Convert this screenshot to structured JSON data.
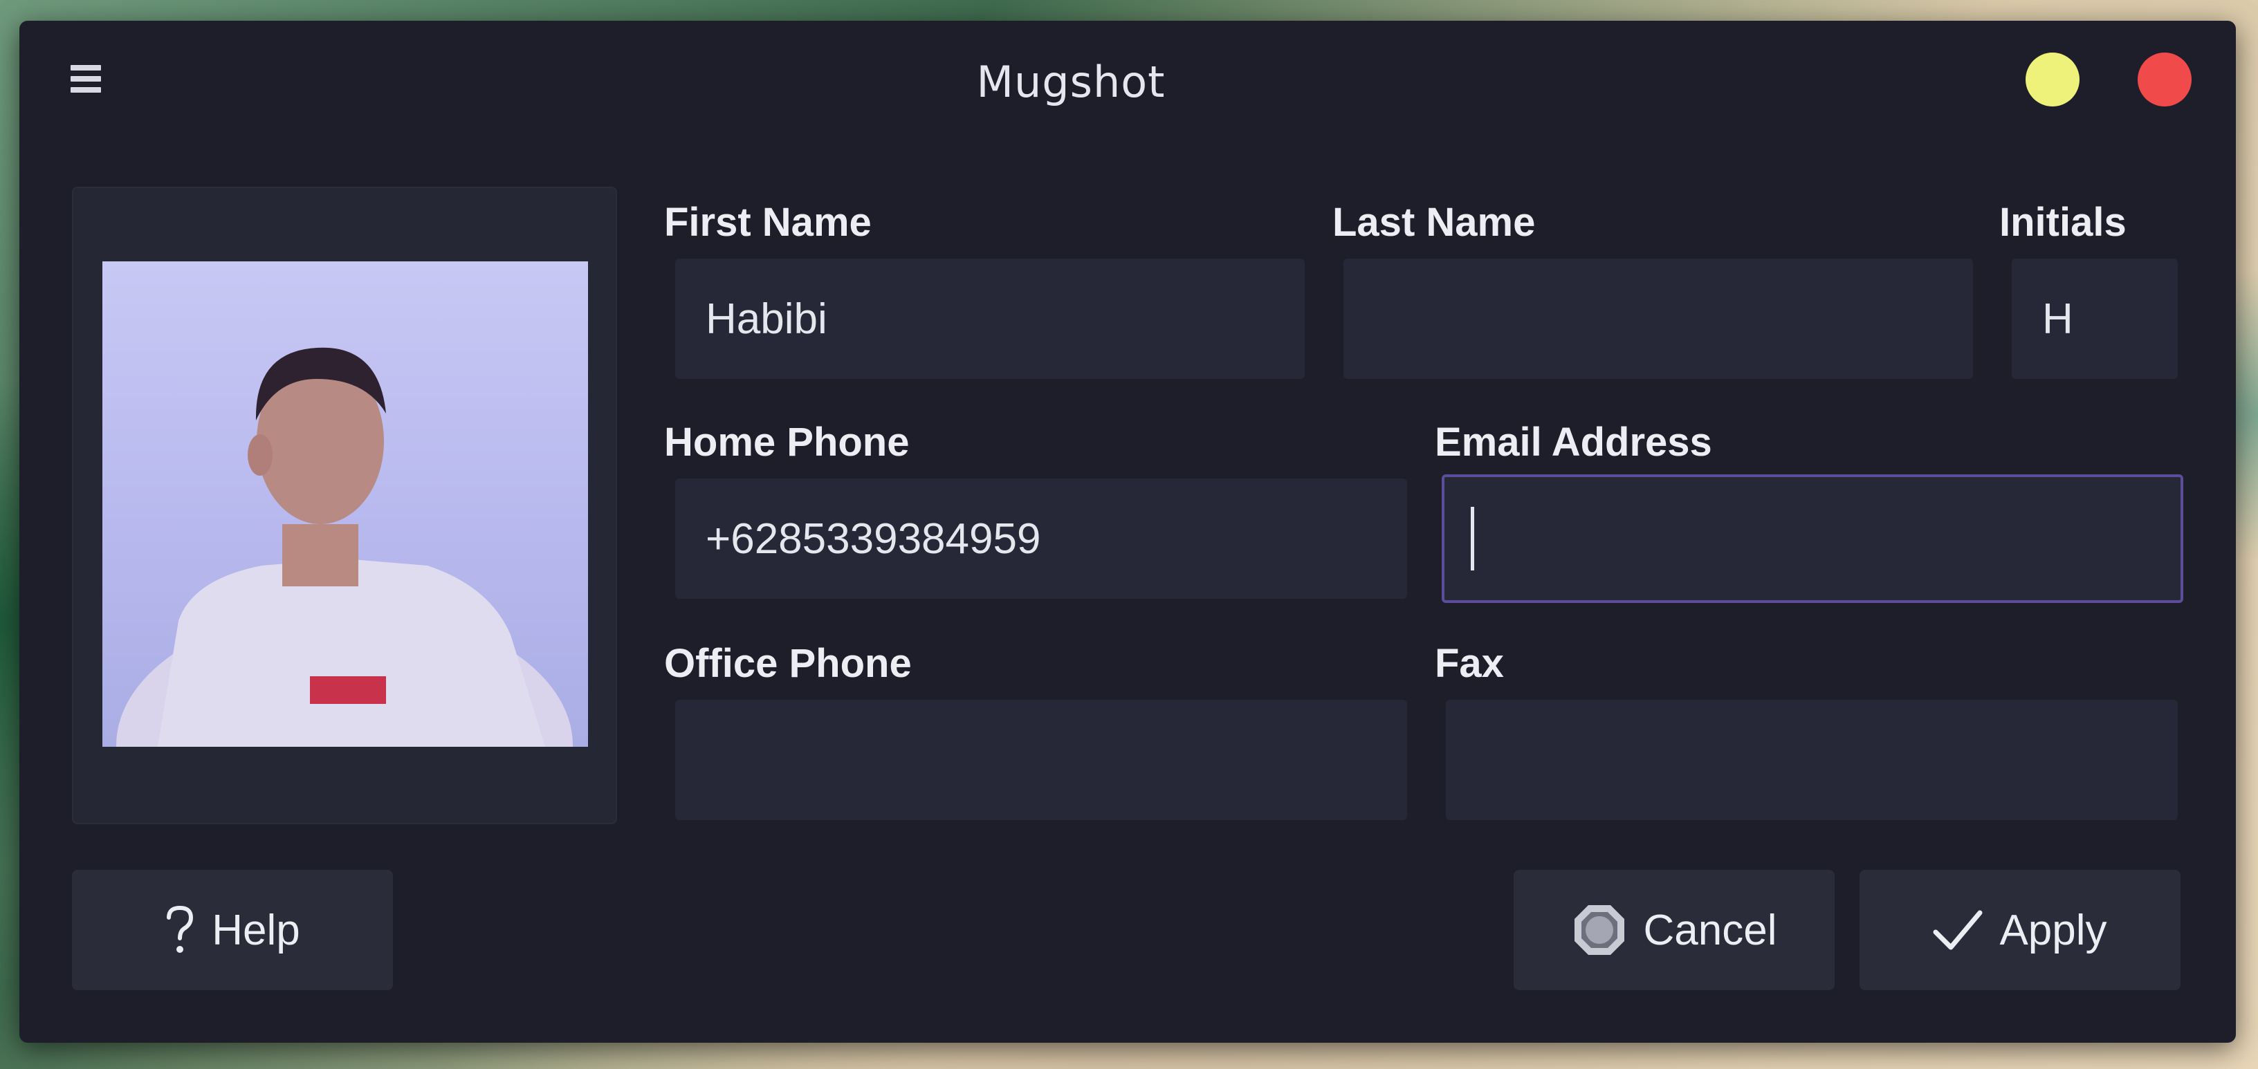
{
  "window": {
    "title": "Mugshot",
    "menu_icon": "hamburger-menu-icon",
    "minimize_icon": "yellow-circle-icon",
    "close_icon": "red-circle-icon"
  },
  "form": {
    "first_name": {
      "label": "First Name",
      "value": "Habibi"
    },
    "last_name": {
      "label": "Last Name",
      "value": ""
    },
    "initials": {
      "label": "Initials",
      "value": "H"
    },
    "home_phone": {
      "label": "Home Phone",
      "value": "+6285339384959"
    },
    "email": {
      "label": "Email Address",
      "value": ""
    },
    "office_phone": {
      "label": "Office Phone",
      "value": ""
    },
    "fax": {
      "label": "Fax",
      "value": ""
    }
  },
  "buttons": {
    "help": {
      "label": "Help",
      "icon": "question-mark-icon"
    },
    "cancel": {
      "label": "Cancel",
      "icon": "stop-octagon-icon"
    },
    "apply": {
      "label": "Apply",
      "icon": "checkmark-icon"
    }
  },
  "colors": {
    "window_bg": "#1d1e2a",
    "field_bg": "#262838",
    "focus_border": "#5b4d9a",
    "minimize": "#eef27a",
    "close": "#f04a4a"
  }
}
